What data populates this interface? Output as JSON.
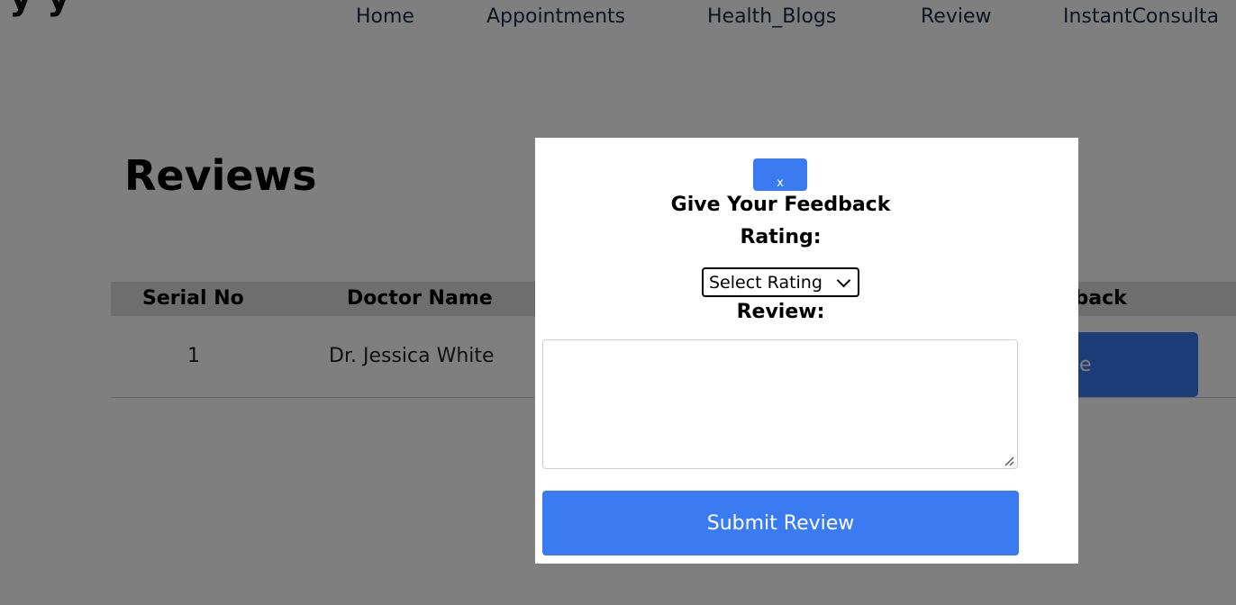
{
  "brand": {
    "text": "y  y"
  },
  "nav": {
    "items": [
      {
        "label": "Home"
      },
      {
        "label": "Appointments"
      },
      {
        "label": "Health_Blogs"
      },
      {
        "label": "Review"
      },
      {
        "label": "InstantConsulta"
      }
    ]
  },
  "page": {
    "title": "Reviews"
  },
  "table": {
    "headers": [
      "Serial No",
      "Doctor Name",
      "lback"
    ],
    "rows": [
      {
        "serial": "1",
        "doctor": "Dr. Jessica White",
        "action": "e"
      }
    ]
  },
  "modal": {
    "close_label": "x",
    "title": "Give Your Feedback",
    "rating_label": "Rating:",
    "rating_select_value": "Select Rating",
    "review_label": "Review:",
    "review_value": "",
    "submit_label": "Submit Review"
  },
  "colors": {
    "primary": "#3b7bf2",
    "overlay": "rgba(0,0,0,0.5)"
  }
}
